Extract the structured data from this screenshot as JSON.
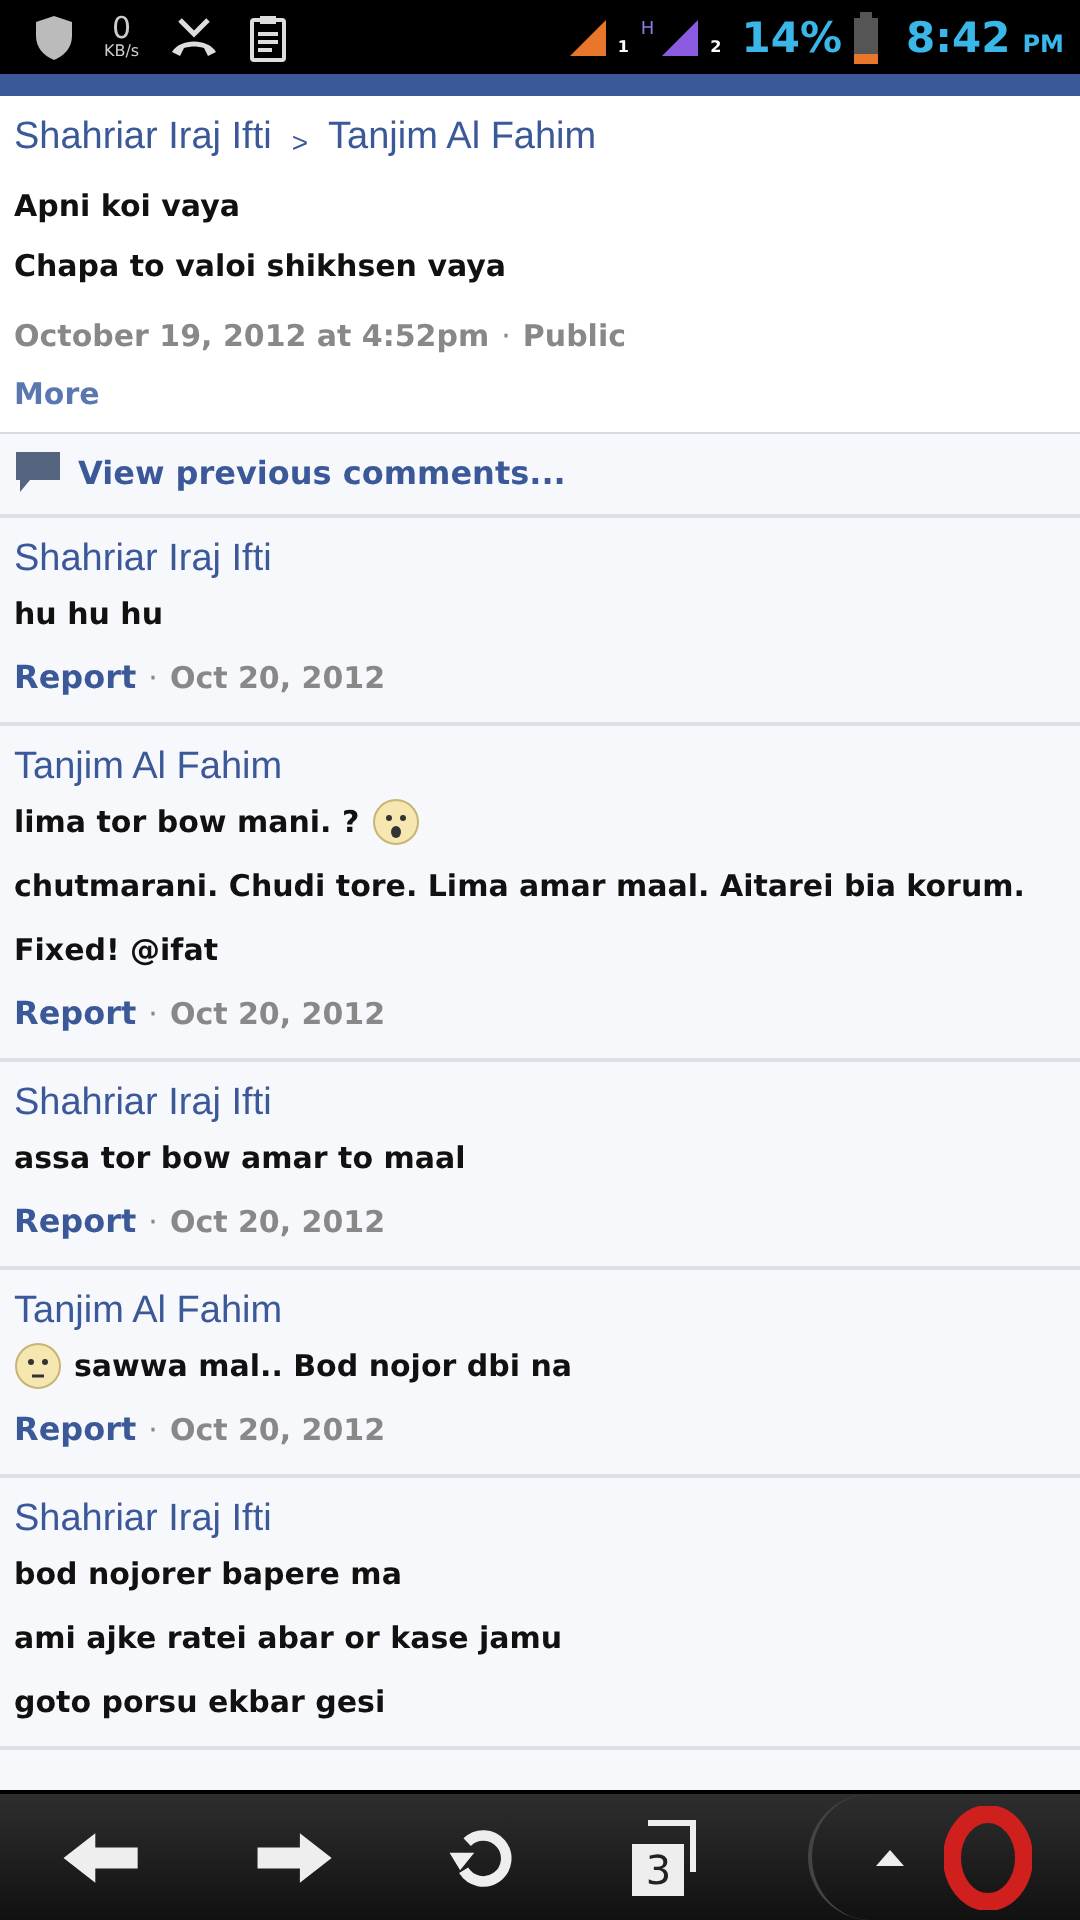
{
  "status_bar": {
    "speed_value": "0",
    "speed_unit": "KB/s",
    "network_type": "H",
    "sim_1": "1",
    "sim_2": "2",
    "battery": "14%",
    "time": "8:42",
    "ampm": "PM"
  },
  "post": {
    "author": "Shahriar Iraj Ifti",
    "separator": ">",
    "target": "Tanjim Al Fahim",
    "lines": [
      "Apni koi vaya",
      "Chapa to valoi shikhsen vaya"
    ],
    "date": "October 19, 2012 at 4:52pm",
    "dot": "·",
    "audience": "Public",
    "more": "More"
  },
  "view_previous": "View previous comments...",
  "comments": [
    {
      "author": "Shahriar Iraj Ifti",
      "lines": [
        {
          "parts": [
            {
              "kind": "text",
              "text": "hu hu hu"
            }
          ]
        }
      ],
      "report": "Report",
      "dot": "·",
      "date": "Oct 20, 2012"
    },
    {
      "author": "Tanjim Al Fahim",
      "lines": [
        {
          "parts": [
            {
              "kind": "text",
              "text": "lima tor bow mani. ?"
            },
            {
              "kind": "surprised"
            }
          ]
        },
        {
          "parts": [
            {
              "kind": "text",
              "text": "chutmarani.  Chudi tore. Lima amar maal. Aitarei  bia korum."
            }
          ]
        },
        {
          "parts": [
            {
              "kind": "text",
              "text": "Fixed!  @ifat"
            }
          ]
        }
      ],
      "report": "Report",
      "dot": "·",
      "date": "Oct 20, 2012"
    },
    {
      "author": "Shahriar Iraj Ifti",
      "lines": [
        {
          "parts": [
            {
              "kind": "text",
              "text": "assa tor bow amar to maal"
            }
          ]
        }
      ],
      "report": "Report",
      "dot": "·",
      "date": "Oct 20, 2012"
    },
    {
      "author": "Tanjim Al Fahim",
      "lines": [
        {
          "parts": [
            {
              "kind": "worried"
            },
            {
              "kind": "text",
              "text": "sawwa mal.. Bod nojor dbi na"
            }
          ]
        }
      ],
      "report": "Report",
      "dot": "·",
      "date": "Oct 20, 2012"
    },
    {
      "author": "Shahriar Iraj Ifti",
      "lines": [
        {
          "parts": [
            {
              "kind": "text",
              "text": "bod nojorer bapere ma"
            }
          ]
        },
        {
          "parts": [
            {
              "kind": "text",
              "text": "ami ajke ratei abar or kase jamu"
            }
          ]
        },
        {
          "parts": [
            {
              "kind": "text",
              "text": "goto porsu ekbar gesi"
            }
          ]
        }
      ]
    }
  ],
  "toolbar": {
    "tab_count": "3"
  }
}
